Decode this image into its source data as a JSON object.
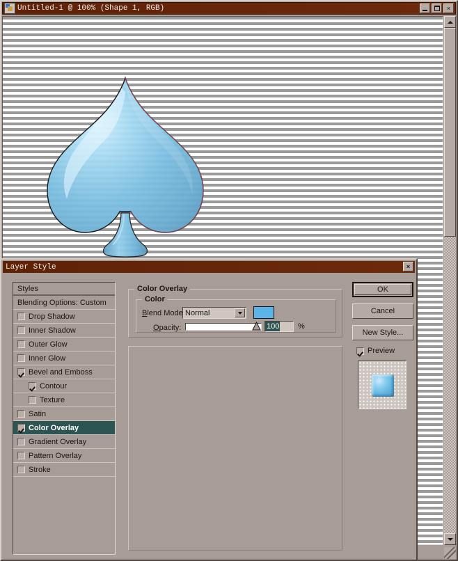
{
  "document_window": {
    "title": "Untitled-1 @ 100% (Shape 1, RGB)",
    "app_icon": "photoshop-document-icon",
    "controls": {
      "minimize": "minimize-icon",
      "maximize": "maximize-icon",
      "close": "×"
    },
    "canvas": {
      "background": "transparency-stripes",
      "shape": "spade"
    }
  },
  "layer_style": {
    "title": "Layer Style",
    "close_label": "×",
    "styles_panel": {
      "header": "Styles",
      "items": [
        {
          "label": "Blending Options: Custom",
          "checkbox": false,
          "checked": false,
          "indent": false,
          "selected": false
        },
        {
          "label": "Drop Shadow",
          "checkbox": true,
          "checked": false,
          "indent": false,
          "selected": false
        },
        {
          "label": "Inner Shadow",
          "checkbox": true,
          "checked": false,
          "indent": false,
          "selected": false
        },
        {
          "label": "Outer Glow",
          "checkbox": true,
          "checked": false,
          "indent": false,
          "selected": false
        },
        {
          "label": "Inner Glow",
          "checkbox": true,
          "checked": false,
          "indent": false,
          "selected": false
        },
        {
          "label": "Bevel and Emboss",
          "checkbox": true,
          "checked": true,
          "indent": false,
          "selected": false
        },
        {
          "label": "Contour",
          "checkbox": true,
          "checked": true,
          "indent": true,
          "selected": false
        },
        {
          "label": "Texture",
          "checkbox": true,
          "checked": false,
          "indent": true,
          "selected": false
        },
        {
          "label": "Satin",
          "checkbox": true,
          "checked": false,
          "indent": false,
          "selected": false
        },
        {
          "label": "Color Overlay",
          "checkbox": true,
          "checked": true,
          "indent": false,
          "selected": true
        },
        {
          "label": "Gradient Overlay",
          "checkbox": true,
          "checked": false,
          "indent": false,
          "selected": false
        },
        {
          "label": "Pattern Overlay",
          "checkbox": true,
          "checked": false,
          "indent": false,
          "selected": false
        },
        {
          "label": "Stroke",
          "checkbox": true,
          "checked": false,
          "indent": false,
          "selected": false
        }
      ]
    },
    "settings": {
      "group_title": "Color Overlay",
      "subgroup_title": "Color",
      "blend_mode_label": "Blend Mode:",
      "blend_mode_value": "Normal",
      "color_swatch_hex": "#5ab4e8",
      "opacity_label": "Opacity:",
      "opacity_value": "100",
      "opacity_unit": "%"
    },
    "buttons": {
      "ok": "OK",
      "cancel": "Cancel",
      "new_style": "New Style...",
      "preview_label": "Preview",
      "preview_checked": true
    }
  },
  "colors": {
    "titlebar": "#6b2408",
    "dialog_face": "#a89c96",
    "selection": "#2c5453",
    "overlay_blue": "#5ab4e8"
  }
}
